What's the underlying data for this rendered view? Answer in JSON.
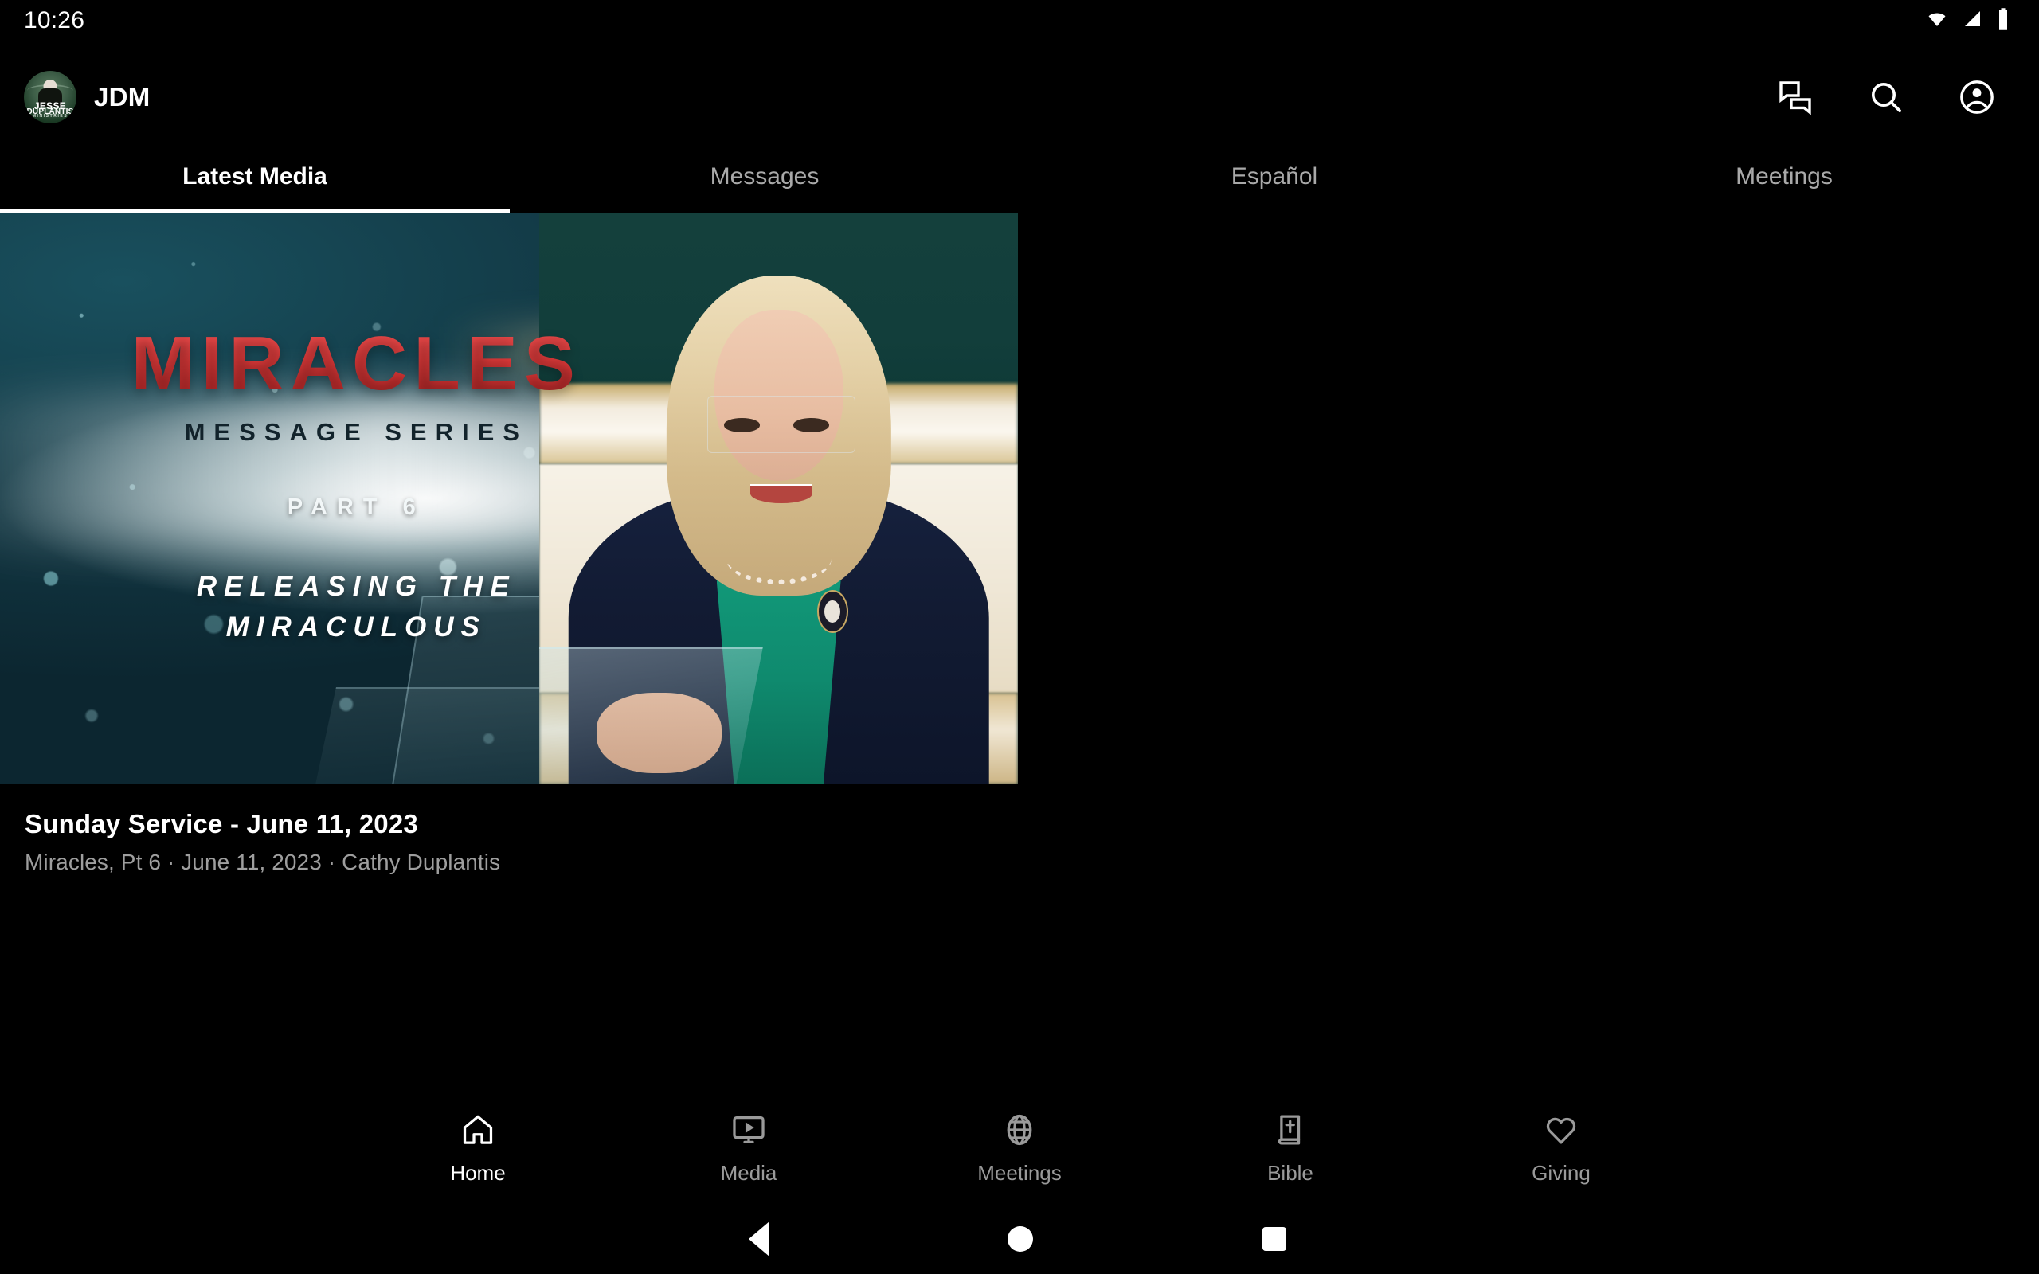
{
  "status_bar": {
    "clock": "10:26",
    "icons": [
      "wifi-icon",
      "cell-signal-icon",
      "battery-icon"
    ]
  },
  "app_bar": {
    "avatar": {
      "name": "avatar",
      "line1": "JESSE",
      "line2": "DUPLANTIS",
      "line3": "MINISTRIES"
    },
    "brand_name": "JDM",
    "actions": [
      {
        "name": "chat-icon",
        "label": "Chat"
      },
      {
        "name": "search-icon",
        "label": "Search"
      },
      {
        "name": "account-circle-icon",
        "label": "Account"
      }
    ]
  },
  "tabs": {
    "active_index": 0,
    "items": [
      {
        "label": "Latest Media"
      },
      {
        "label": "Messages"
      },
      {
        "label": "Español"
      },
      {
        "label": "Meetings"
      }
    ]
  },
  "featured": {
    "thumbnail": {
      "series_title": "MIRACLES",
      "series_subtitle": "MESSAGE SERIES",
      "part": "PART 6",
      "episode_line1": "RELEASING THE",
      "episode_line2": "MIRACULOUS"
    },
    "title": "Sunday Service - June 11, 2023",
    "subtitle": "Miracles, Pt 6 · June 11, 2023 · Cathy Duplantis"
  },
  "bottom_nav": {
    "active_index": 0,
    "items": [
      {
        "label": "Home",
        "icon": "home-icon"
      },
      {
        "label": "Media",
        "icon": "media-play-icon"
      },
      {
        "label": "Meetings",
        "icon": "globe-icon"
      },
      {
        "label": "Bible",
        "icon": "bible-icon"
      },
      {
        "label": "Giving",
        "icon": "heart-icon"
      }
    ]
  },
  "system_nav": {
    "back": "back-button",
    "home": "home-button",
    "recents": "recents-button"
  },
  "colors": {
    "background": "#000000",
    "accent": "#ffffff",
    "muted_text": "#9e9e9e",
    "series_red": "#e03a3a"
  }
}
